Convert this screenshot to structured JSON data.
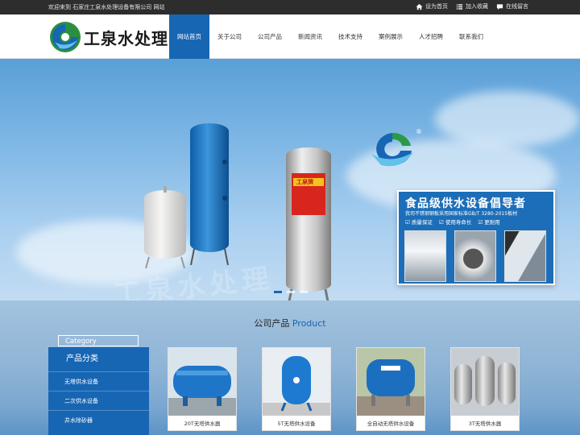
{
  "topbar": {
    "welcome": "欢迎来到 石家庄工泉水处理设备有限公司 网站",
    "links": [
      {
        "icon": "home-icon",
        "label": "设为首页"
      },
      {
        "icon": "bookmark-icon",
        "label": "加入收藏"
      },
      {
        "icon": "chat-icon",
        "label": "在线留言"
      }
    ]
  },
  "header": {
    "logo_text": "工泉水处理",
    "nav": [
      "网站首页",
      "关于公司",
      "公司产品",
      "新闻资讯",
      "技术支持",
      "案例展示",
      "人才招聘",
      "联系我们"
    ],
    "active_index": 0
  },
  "banner": {
    "tank_label": "工泉牌",
    "registered_mark": "®",
    "watermark": "工泉水处理",
    "card": {
      "title": "食品级供水设备倡导者",
      "subtitle": "我司不锈钢钢板采用国家标准GB/T 3280-2015板材",
      "features": [
        "质量保证",
        "使用寿命长",
        "更耐用"
      ]
    },
    "slides": 3,
    "active_slide": 0
  },
  "products": {
    "title_cn": "公司产品",
    "title_en": "Product",
    "category": {
      "en": "Category",
      "cn": "产品分类",
      "items": [
        "无塔供水设备",
        "二次供水设备",
        "井水除砂器"
      ]
    },
    "items": [
      {
        "name": "20T无塔供水器"
      },
      {
        "name": "5T无塔供水设备"
      },
      {
        "name": "全自动无塔供水设备"
      },
      {
        "name": "3T无塔供水器"
      }
    ]
  },
  "colors": {
    "brand_blue": "#1766b4",
    "topbar_bg": "#2d2d2d"
  }
}
